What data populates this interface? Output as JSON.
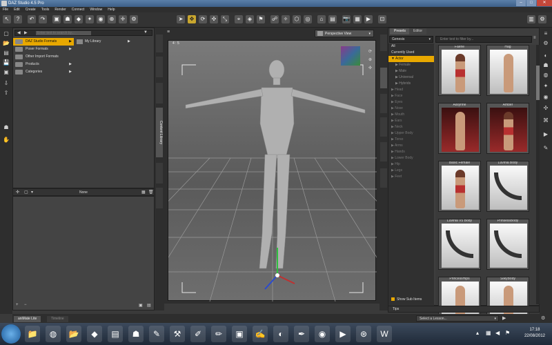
{
  "window": {
    "title": "DAZ Studio 4.5 Pro",
    "btn_min": "–",
    "btn_max": "□",
    "btn_close": "✕"
  },
  "menu": [
    "File",
    "Edit",
    "Create",
    "Tools",
    "Render",
    "Connect",
    "Window",
    "Help"
  ],
  "library": {
    "search_placeholder": "Enter text to search by...",
    "rows": [
      "DAZ Studio Formats",
      "Poser Formats",
      "Other Import Formats",
      "Products",
      "Categories"
    ],
    "selected_row": 0,
    "my_library": "My Library",
    "footer_label": "None"
  },
  "left_tabs": [
    "Content Library"
  ],
  "viewport": {
    "view_label": "Perspective View",
    "corner_label": "4 : 5"
  },
  "content": {
    "tabs": [
      "Presets",
      "Editor"
    ],
    "genesis": "Genesis",
    "filter_placeholder": "Enter text to filter by...",
    "categories": [
      {
        "label": "All",
        "kind": "normal"
      },
      {
        "label": "Currently Used",
        "kind": "normal"
      },
      {
        "label": "▼ Actor",
        "kind": "sel"
      },
      {
        "label": "▶ Female",
        "kind": "sub"
      },
      {
        "label": "▶ Male",
        "kind": "sub"
      },
      {
        "label": "▶ Universal",
        "kind": "sub"
      },
      {
        "label": "▶ Hybrids",
        "kind": "sub"
      },
      {
        "label": "▶ Head",
        "kind": "dim"
      },
      {
        "label": "▶ Face",
        "kind": "dim"
      },
      {
        "label": "▶ Eyes",
        "kind": "dim"
      },
      {
        "label": "▶ Nose",
        "kind": "dim"
      },
      {
        "label": "▶ Mouth",
        "kind": "dim"
      },
      {
        "label": "▶ Ears",
        "kind": "dim"
      },
      {
        "label": "▶ Neck",
        "kind": "dim"
      },
      {
        "label": "▶ Upper Body",
        "kind": "dim"
      },
      {
        "label": "▶ Torso",
        "kind": "dim"
      },
      {
        "label": "▶ Arms",
        "kind": "dim"
      },
      {
        "label": "▶ Hands",
        "kind": "dim"
      },
      {
        "label": "▶ Lower Body",
        "kind": "dim"
      },
      {
        "label": "▶ Hip",
        "kind": "dim"
      },
      {
        "label": "▶ Legs",
        "kind": "dim"
      },
      {
        "label": "▶ Feet",
        "kind": "dim"
      }
    ],
    "show_sub": "Show Sub Items",
    "thumbnails": [
      "Faerie",
      "Hag",
      "Aislynne",
      "Amber",
      "Basic Female",
      "Luvinia Body",
      "Luvinia V5 Body",
      "PrinsessBody",
      "PrincessHips",
      "SilkyBody"
    ]
  },
  "tips_label": "Tips",
  "bottom_tabs": [
    "aniMate Lite",
    "Timeline"
  ],
  "lesson_placeholder": "Select a Lesson...",
  "clock": {
    "time": "17:18",
    "date": "22/08/2012"
  },
  "colors": {
    "accent": "#e8a800",
    "panel": "#3e3e3e",
    "viewport": "#6e6e6e"
  }
}
